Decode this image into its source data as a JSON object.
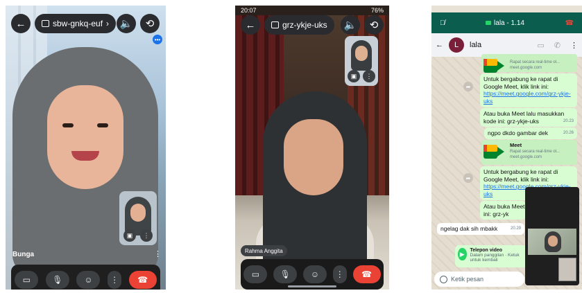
{
  "phone1": {
    "meeting_code": "sbw-gnkq-euf",
    "participant_name": "Bunga",
    "icons": [
      "back-arrow-icon",
      "calendar-icon",
      "speaker-icon",
      "switch-camera-icon",
      "more-dots-icon",
      "camera-icon",
      "mic-icon",
      "emoji-icon",
      "more-vert-icon",
      "end-call-icon"
    ]
  },
  "phone2": {
    "status_time": "20:07",
    "status_right": "76%",
    "meeting_code": "grz-ykje-uks",
    "participant_name": "Rahma Anggita"
  },
  "phone3": {
    "call_banner": "lala - 1.14",
    "contact_name": "lala",
    "contact_initial": "L",
    "card_top": {
      "subtitle": "Rapat secara real-time ol...",
      "domain": "meet.google.com"
    },
    "msg1": {
      "text": "Untuk bergabung ke rapat di Google Meet, klik link ini:",
      "link": "https://meet.google.com/grz-ykje-uks"
    },
    "msg2": {
      "text": "Atau buka Meet lalu masukkan kode ini: grz-ykje-uks",
      "time": "20.23"
    },
    "msg3": {
      "text": "ngpo dkdo gambar dek",
      "time": "20.26"
    },
    "card_meet": {
      "title": "Meet",
      "subtitle": "Rapat secara real-time ol...",
      "domain": "meet.google.com"
    },
    "msg4": {
      "text": "Untuk bergabung ke rapat di Google Meet, klik link ini:",
      "link": "https://meet.google.com/grz-ykje-uks"
    },
    "msg5": {
      "text": "Atau buka Meet lalu masukkan kode ini: grz-yk"
    },
    "msg6": {
      "text": "ngelag dak sih mbakk",
      "time": "20.29"
    },
    "video_call": {
      "title": "Telepon video",
      "subtitle": "Dalam panggilan · Ketuk untuk kembali"
    },
    "input_placeholder": "Ketik pesan"
  }
}
